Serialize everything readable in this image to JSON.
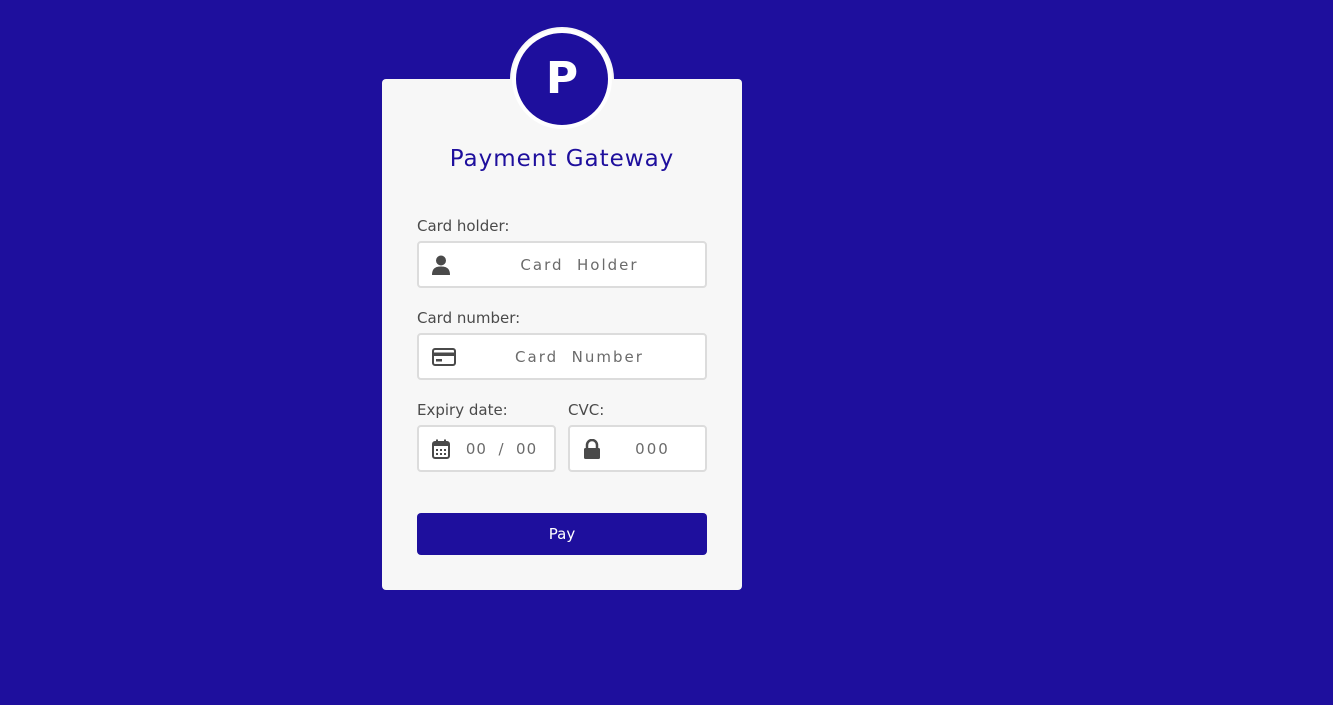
{
  "logo": {
    "letter": "P"
  },
  "title": "Payment Gateway",
  "card_holder": {
    "label": "Card holder:",
    "placeholder": "Card  Holder",
    "icon": "user-icon"
  },
  "card_number": {
    "label": "Card number:",
    "placeholder": "Card  Number",
    "icon": "credit-card-icon"
  },
  "expiry": {
    "label": "Expiry date:",
    "placeholder": "00  /  00",
    "icon": "calendar-icon"
  },
  "cvc": {
    "label": "CVC:",
    "placeholder": "000",
    "icon": "lock-icon"
  },
  "pay_button": {
    "label": "Pay"
  },
  "colors": {
    "background": "#1e0f9d",
    "card": "#f7f7f7",
    "accent": "#1e0f9d"
  }
}
